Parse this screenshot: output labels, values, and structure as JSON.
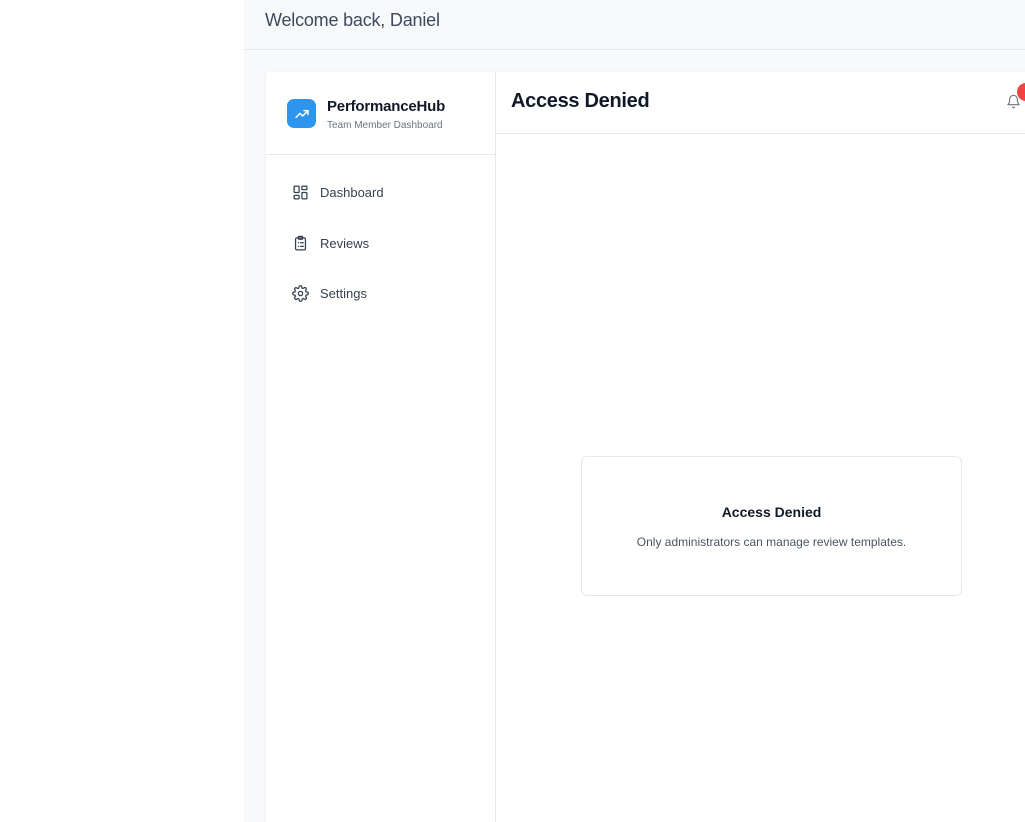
{
  "topbar": {
    "welcome": "Welcome back, Daniel"
  },
  "brand": {
    "name": "PerformanceHub",
    "subtitle": "Team Member Dashboard",
    "logo_icon": "trending-up-icon",
    "accent": "#2d95ee"
  },
  "sidebar": {
    "items": [
      {
        "label": "Dashboard",
        "icon": "layout-grid-icon"
      },
      {
        "label": "Reviews",
        "icon": "clipboard-list-icon"
      },
      {
        "label": "Settings",
        "icon": "gear-icon"
      }
    ]
  },
  "header": {
    "title": "Access Denied",
    "bell_icon": "bell-icon",
    "badge_color": "#ef4444"
  },
  "notice": {
    "title": "Access Denied",
    "message": "Only administrators can manage review templates."
  }
}
